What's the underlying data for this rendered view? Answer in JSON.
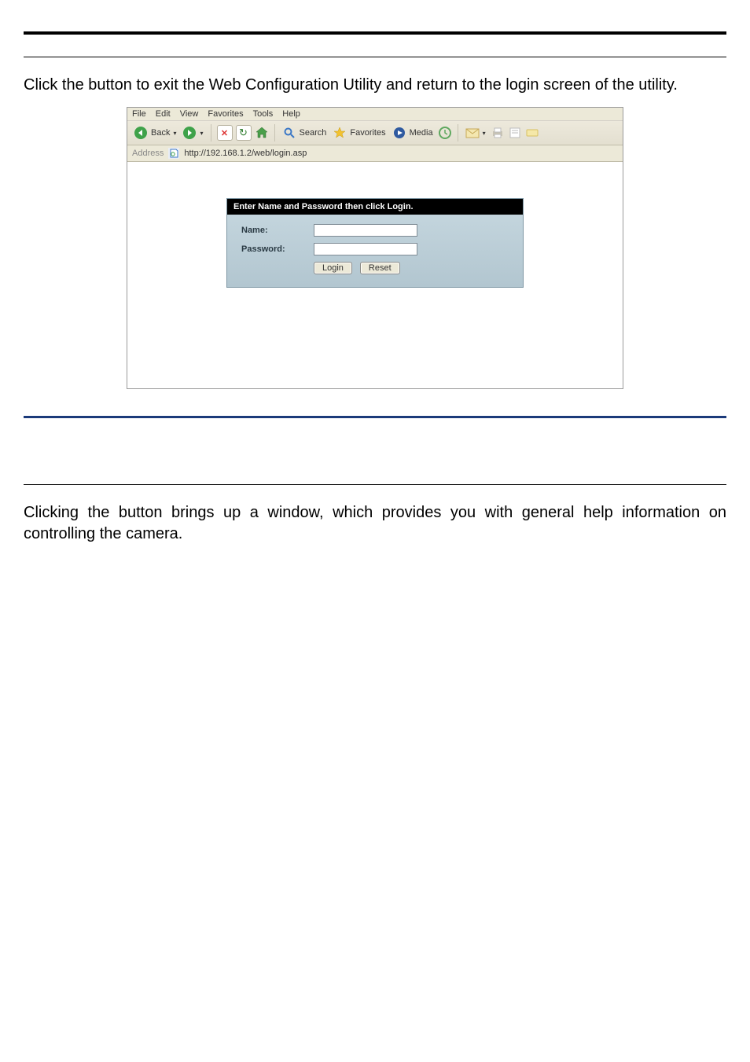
{
  "section1": {
    "paragraph": "Click the                 button to exit the Web Configuration Utility and return to the login screen of the utility."
  },
  "ie": {
    "menu": {
      "file": "File",
      "edit": "Edit",
      "view": "View",
      "favorites": "Favorites",
      "tools": "Tools",
      "help": "Help"
    },
    "toolbar": {
      "back": "Back",
      "search": "Search",
      "favorites": "Favorites",
      "media": "Media"
    },
    "addressbar": {
      "label": "Address",
      "url": "http://192.168.1.2/web/login.asp"
    },
    "login": {
      "header": "Enter Name and Password then click Login.",
      "name_label": "Name:",
      "password_label": "Password:",
      "login_btn": "Login",
      "reset_btn": "Reset"
    }
  },
  "section2": {
    "paragraph": "Clicking the           button brings up a window, which provides you with general help information on controlling the camera."
  }
}
